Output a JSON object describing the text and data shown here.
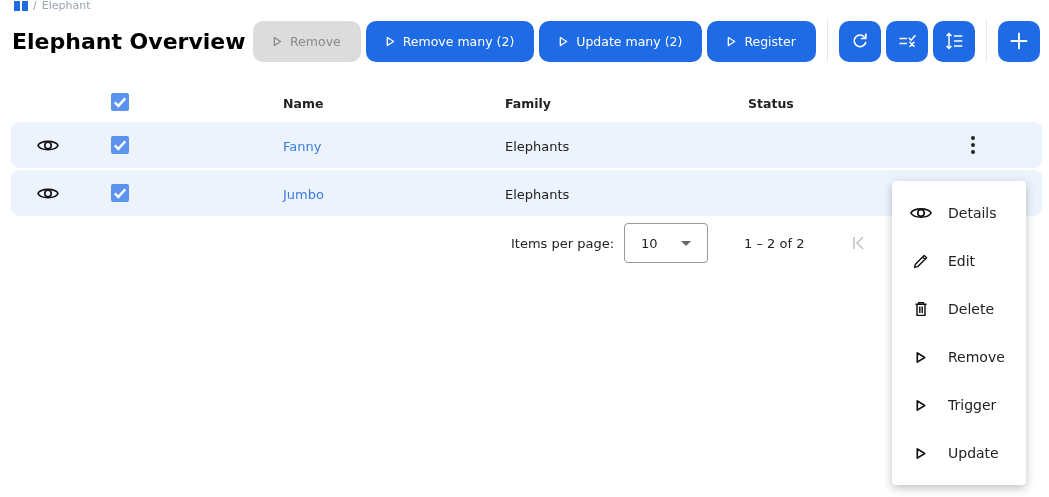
{
  "breadcrumb": {
    "separator": "/",
    "current": "Elephant"
  },
  "title": "Elephant Overview",
  "actions": [
    {
      "kind": "text",
      "label": "Remove",
      "disabled": true
    },
    {
      "kind": "text",
      "label": "Remove many (2)",
      "disabled": false
    },
    {
      "kind": "text",
      "label": "Update many (2)",
      "disabled": false
    },
    {
      "kind": "text",
      "label": "Register",
      "disabled": false
    },
    {
      "kind": "divider"
    },
    {
      "kind": "refresh",
      "disabled": false
    },
    {
      "kind": "checklist",
      "disabled": false
    },
    {
      "kind": "sort",
      "disabled": false
    },
    {
      "kind": "divider"
    },
    {
      "kind": "add",
      "disabled": false
    }
  ],
  "table": {
    "select_all": {
      "checked": true
    },
    "columns": [
      "Name",
      "Family",
      "Status"
    ],
    "rows": [
      {
        "checked": true,
        "name": "Fanny",
        "family": "Elephants",
        "menu_button": true
      },
      {
        "checked": true,
        "name": "Jumbo",
        "family": "Elephants",
        "menu_button": false
      }
    ]
  },
  "pagination": {
    "label": "Items per page:",
    "page_size": "10",
    "range": "1 – 2 of 2"
  },
  "row_menu": [
    {
      "kind": "eye",
      "label": "Details"
    },
    {
      "kind": "pencil",
      "label": "Edit"
    },
    {
      "kind": "trash",
      "label": "Delete"
    },
    {
      "kind": "play",
      "label": "Remove"
    },
    {
      "kind": "play",
      "label": "Trigger"
    },
    {
      "kind": "play",
      "label": "Update"
    }
  ]
}
